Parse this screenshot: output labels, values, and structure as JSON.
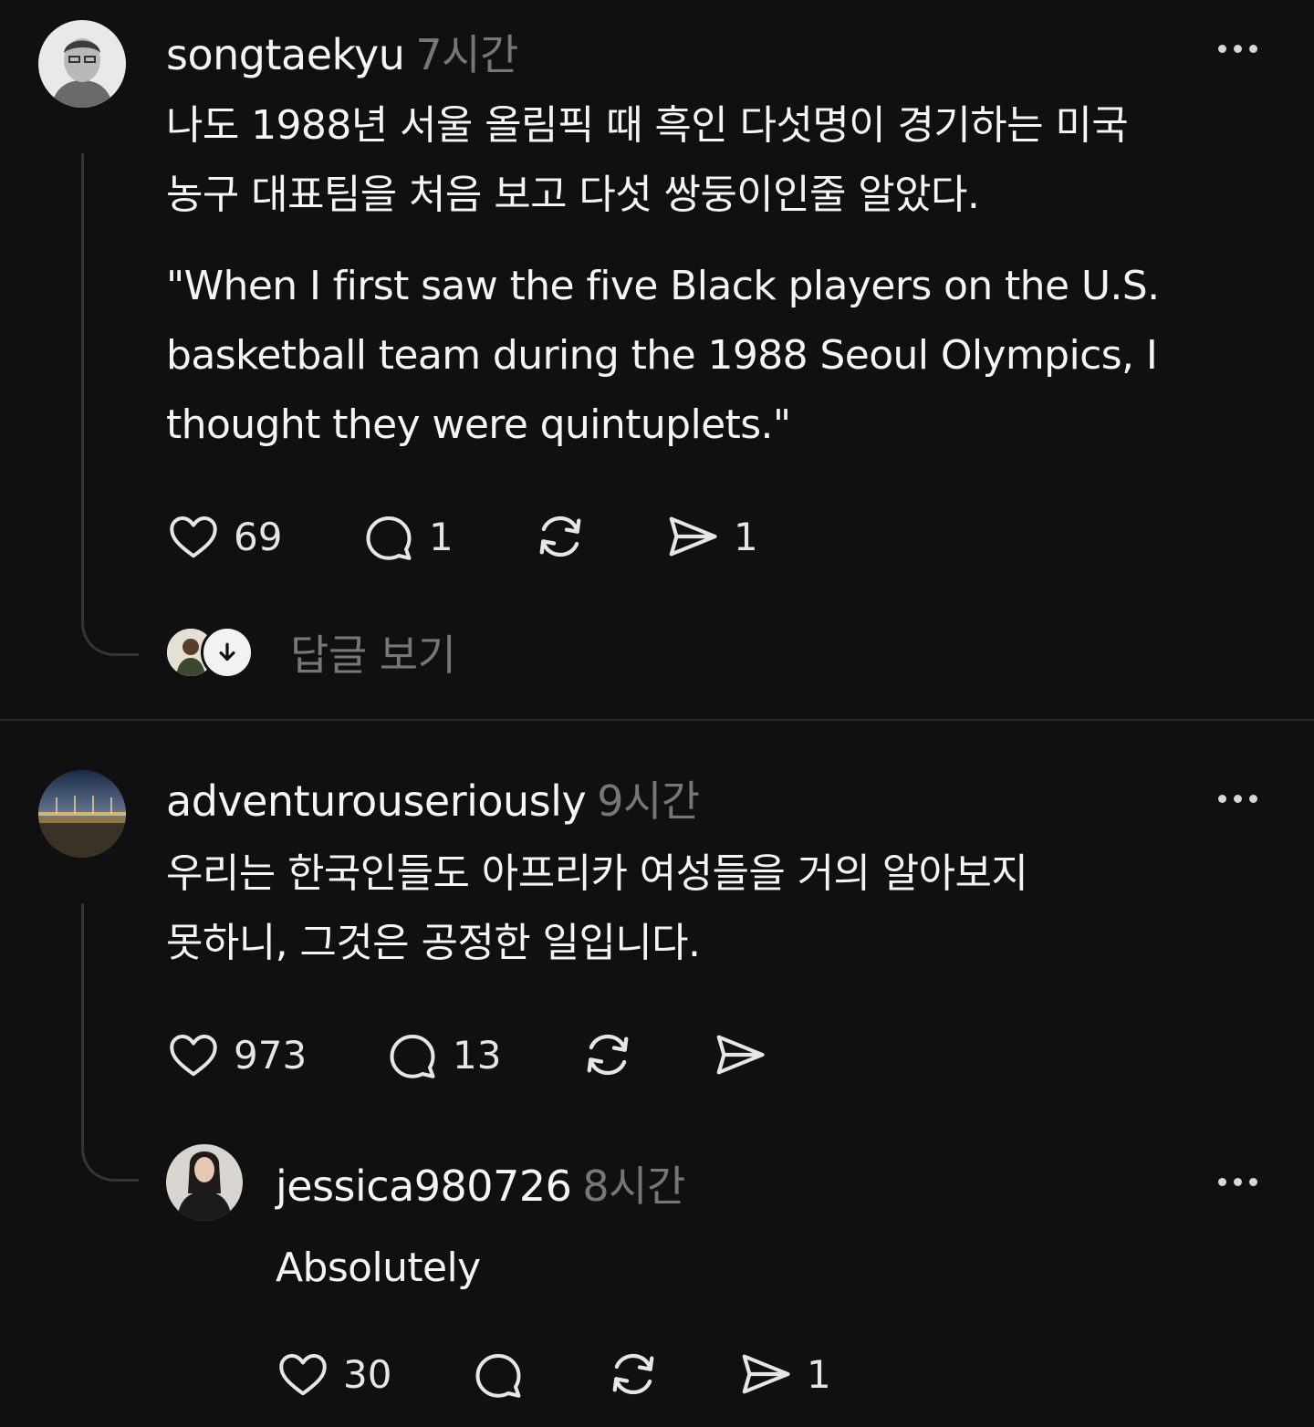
{
  "posts": [
    {
      "username": "songtaekyu",
      "time": "7시간",
      "text_ko": "나도 1988년 서울 올림픽 때 흑인 다섯명이 경기하는 미국\n농구 대표팀을 처음 보고 다섯 쌍둥이인줄 알았다.",
      "text_en": "\"When I first saw the five Black players on the U.S.\nbasketball team during the 1988 Seoul Olympics, I\nthought they were quintuplets.\"",
      "likes": "69",
      "comments": "1",
      "shares": "1",
      "view_replies": "답글 보기"
    },
    {
      "username": "adventurouseriously",
      "time": "9시간",
      "text_ko": "우리는 한국인들도 아프리카 여성들을 거의 알아보지\n못하니, 그것은 공정한 일입니다.",
      "likes": "973",
      "comments": "13"
    },
    {
      "username": "jessica980726",
      "time": "8시간",
      "text": "Absolutely",
      "likes": "30",
      "shares": "1"
    }
  ],
  "icons": {
    "like": "heart-icon",
    "comment": "comment-bubble-icon",
    "repost": "repost-icon",
    "share": "send-icon",
    "more": "more-dots-icon",
    "expand": "arrow-down-icon"
  },
  "colors": {
    "background": "#101010",
    "primary_text": "#f3f5f7",
    "secondary_text": "#777777",
    "thread_line": "#333638"
  }
}
